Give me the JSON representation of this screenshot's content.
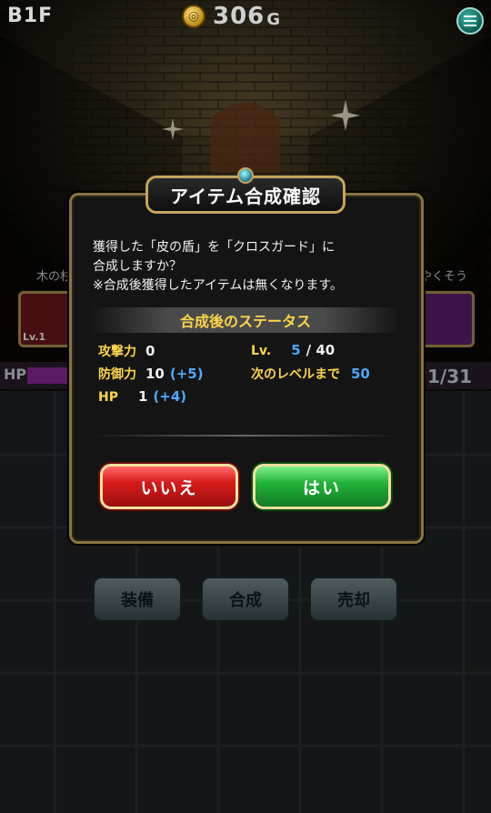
{
  "hud": {
    "floor": "B1F",
    "coin_icon": "coin-icon",
    "gold_amount": "306",
    "gold_unit": "G",
    "menu_icon": "menu-icon"
  },
  "background": {
    "left_item_label": "木の杉",
    "left_item_level": "Lv.1",
    "right_item_label": "やくそう",
    "hp_label": "HP",
    "hp_count": "1/31",
    "buttons": [
      "装備",
      "合成",
      "売却"
    ]
  },
  "dialog": {
    "title": "アイテム合成確認",
    "message_line1": "獲得した「皮の盾」を「クロスガード」に",
    "message_line2": "合成しますか？",
    "message_line3": "※合成後獲得したアイテムは無くなります。",
    "status_header": "合成後のステータス",
    "stats": {
      "attack_label": "攻撃力",
      "attack_value": "0",
      "defense_label": "防御力",
      "defense_value": "10",
      "defense_bonus": "(+5)",
      "hp_label": "HP",
      "hp_value": "1",
      "hp_bonus": "(+4)",
      "level_label": "Lv.",
      "level_current": "5",
      "level_max": "/ 40",
      "next_label": "次のレベルまで",
      "next_value": "50"
    },
    "no_button": "いいえ",
    "yes_button": "はい"
  },
  "colors": {
    "accent_gold": "#ffd54a",
    "bonus_blue": "#4fa8ff",
    "no_red": "#d81b1b",
    "yes_green": "#23b43a"
  }
}
